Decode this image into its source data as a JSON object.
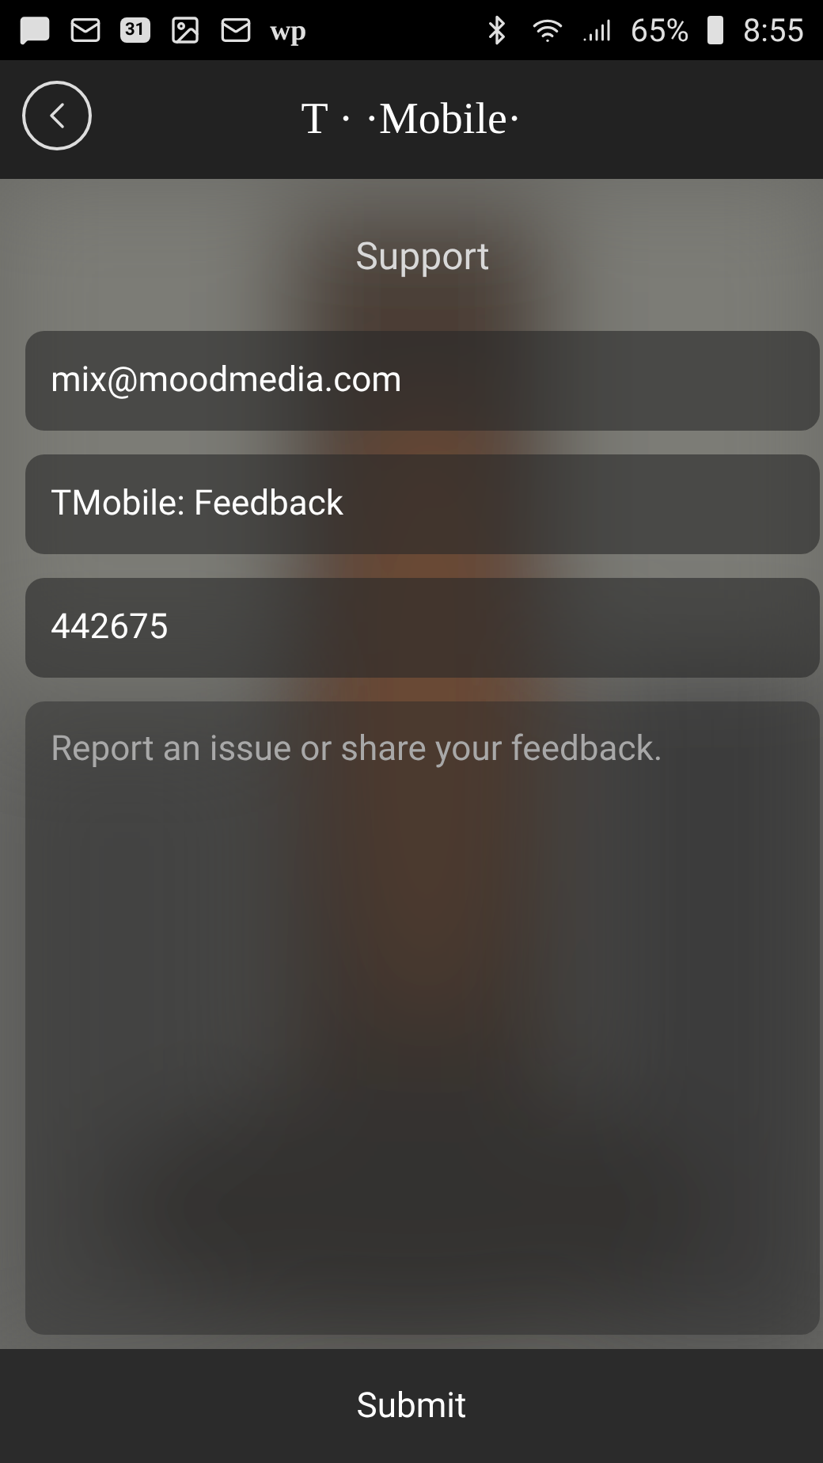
{
  "status_bar": {
    "calendar_day": "31",
    "news_label": "wp",
    "battery": "65%",
    "time": "8:55"
  },
  "header": {
    "brand": "T · ·Mobile·"
  },
  "form": {
    "title": "Support",
    "fields": [
      {
        "kind": "input",
        "value": "mix@moodmedia.com"
      },
      {
        "kind": "input",
        "value": "TMobile: Feedback"
      },
      {
        "kind": "input",
        "value": "442675"
      },
      {
        "kind": "textarea",
        "placeholder": "Report an issue or share your feedback."
      }
    ]
  },
  "submit": "Submit"
}
